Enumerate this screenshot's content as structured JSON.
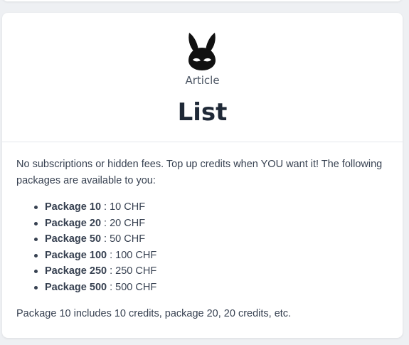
{
  "card": {
    "category": "Article",
    "title": "List",
    "intro": "No subscriptions or hidden fees. Top up credits when YOU want it! The following packages are available to you:",
    "packages": [
      {
        "name": "Package 10",
        "price": " : 10 CHF"
      },
      {
        "name": "Package 20",
        "price": " : 20 CHF"
      },
      {
        "name": "Package 50",
        "price": " : 50 CHF"
      },
      {
        "name": "Package 100",
        "price": " : 100 CHF"
      },
      {
        "name": "Package 250",
        "price": " : 250 CHF"
      },
      {
        "name": "Package 500",
        "price": " : 500 CHF"
      }
    ],
    "note": "Package 10 includes 10 credits, package 20, 20 credits, etc."
  },
  "icons": {
    "logo": "bunny-mask-logo"
  },
  "colors": {
    "background": "#eef0f3",
    "card": "#ffffff",
    "title": "#1f2937",
    "text": "#374151"
  }
}
